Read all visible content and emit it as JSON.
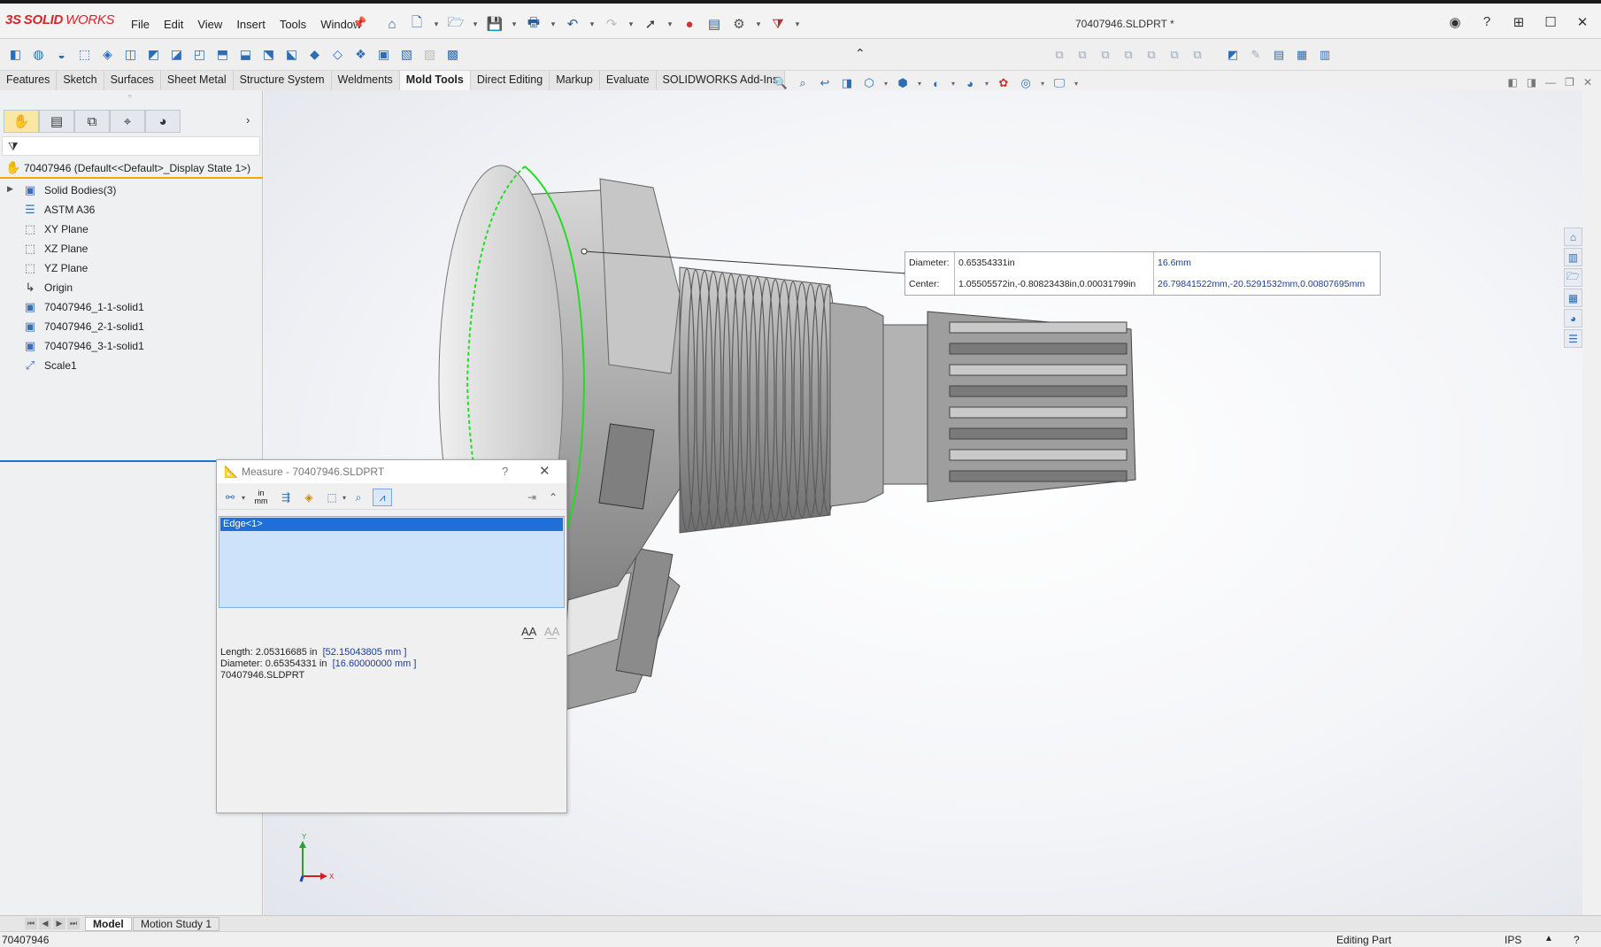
{
  "app": {
    "logo_ds": "3S",
    "logo_solid": "SOLID",
    "logo_works": "WORKS",
    "document_title": "70407946.SLDPRT *"
  },
  "menu": [
    "File",
    "Edit",
    "View",
    "Insert",
    "Tools",
    "Window"
  ],
  "command_tabs": [
    {
      "label": "Features",
      "active": false
    },
    {
      "label": "Sketch",
      "active": false
    },
    {
      "label": "Surfaces",
      "active": false
    },
    {
      "label": "Sheet Metal",
      "active": false
    },
    {
      "label": "Structure System",
      "active": false
    },
    {
      "label": "Weldments",
      "active": false
    },
    {
      "label": "Mold Tools",
      "active": true
    },
    {
      "label": "Direct Editing",
      "active": false
    },
    {
      "label": "Markup",
      "active": false
    },
    {
      "label": "Evaluate",
      "active": false
    },
    {
      "label": "SOLIDWORKS Add-Ins",
      "active": false
    }
  ],
  "feature_tree": {
    "root": "70407946  (Default<<Default>_Display State 1>)",
    "items": [
      {
        "label": "Solid Bodies(3)",
        "icon": "solid-bodies-icon",
        "expandable": true
      },
      {
        "label": "ASTM A36",
        "icon": "material-icon",
        "expandable": false
      },
      {
        "label": "XY Plane",
        "icon": "plane-icon",
        "expandable": false
      },
      {
        "label": "XZ Plane",
        "icon": "plane-icon",
        "expandable": false
      },
      {
        "label": "YZ Plane",
        "icon": "plane-icon",
        "expandable": false
      },
      {
        "label": "Origin",
        "icon": "origin-icon",
        "expandable": false
      },
      {
        "label": "70407946_1-1-solid1",
        "icon": "body-icon",
        "expandable": false
      },
      {
        "label": "70407946_2-1-solid1",
        "icon": "body-icon",
        "expandable": false
      },
      {
        "label": "70407946_3-1-solid1",
        "icon": "body-icon",
        "expandable": false
      },
      {
        "label": "Scale1",
        "icon": "scale-icon",
        "expandable": false
      }
    ]
  },
  "callout": {
    "diameter_label": "Diameter:",
    "center_label": "Center:",
    "diameter_in": "0.65354331in",
    "center_in": "1.05505572in,-0.80823438in,0.00031799in",
    "diameter_mm": "16.6mm",
    "center_mm": "26.79841522mm,-20.5291532mm,0.00807695mm"
  },
  "measure_dialog": {
    "title": "Measure - 70407946.SLDPRT",
    "help": "?",
    "units_in": "in",
    "units_mm": "mm",
    "selection": "Edge<1>",
    "length_label": "Length: 2.05316685 in",
    "length_mm": "[52.15043805 mm ]",
    "diameter_label": "Diameter: 0.65354331 in",
    "diameter_mm": "[16.60000000 mm ]",
    "file": "70407946.SLDPRT"
  },
  "triad": {
    "x": "X",
    "y": "Y"
  },
  "bottom_tabs": [
    {
      "label": "Model",
      "active": true
    },
    {
      "label": "Motion Study 1",
      "active": false
    }
  ],
  "status": {
    "left": "70407946",
    "mode": "Editing Part",
    "units": "IPS"
  },
  "colors": {
    "accent": "#1f6fd6",
    "brand": "#d8262b",
    "edge_highlight": "#22dd22",
    "tree_highlight": "#f3a800"
  }
}
